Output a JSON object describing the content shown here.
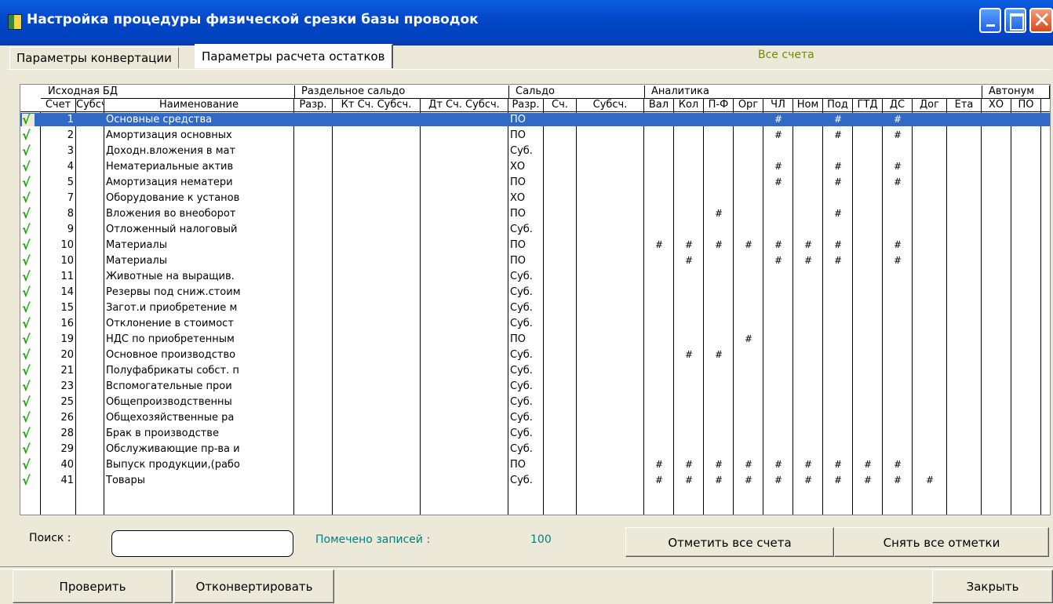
{
  "window": {
    "title": "Настройка процедуры физической срезки базы проводок"
  },
  "tabs": [
    {
      "label": "Параметры конвертации"
    },
    {
      "label": "Параметры расчета остатков"
    }
  ],
  "tabs_note": "Все счета",
  "grid": {
    "groups": [
      "Исходная БД",
      "Раздельное сальдо",
      "Сальдо",
      "Аналитика",
      "Автонум"
    ],
    "columns": [
      "Счет",
      "Субсч",
      "Наименование",
      "Разр.",
      "Кт Сч. Субсч.",
      "Дт Сч. Субсч.",
      "Разр.",
      "Сч.",
      "Субсч.",
      "Вал",
      "Кол",
      "П-Ф",
      "Орг",
      "ЧЛ",
      "Ном",
      "Под",
      "ГТД",
      "ДС",
      "Дог",
      "Ета",
      "ХО",
      "ПО"
    ],
    "rows": [
      {
        "acc": "1",
        "name": "Основные средства",
        "saldo": "ПО",
        "marks": [
          "",
          "",
          "",
          "",
          "#",
          "",
          "#",
          "",
          "#",
          "",
          ""
        ]
      },
      {
        "acc": "2",
        "name": "Амортизация основных",
        "saldo": "ПО",
        "marks": [
          "",
          "",
          "",
          "",
          "#",
          "",
          "#",
          "",
          "#",
          "",
          ""
        ]
      },
      {
        "acc": "3",
        "name": "Доходн.вложения в мат",
        "saldo": "Суб.",
        "marks": [
          "",
          "",
          "",
          "",
          "",
          "",
          "",
          "",
          "",
          "",
          ""
        ]
      },
      {
        "acc": "4",
        "name": "Нематериальные актив",
        "saldo": "ХО",
        "marks": [
          "",
          "",
          "",
          "",
          "#",
          "",
          "#",
          "",
          "#",
          "",
          ""
        ]
      },
      {
        "acc": "5",
        "name": "Амортизация нематери",
        "saldo": "ПО",
        "marks": [
          "",
          "",
          "",
          "",
          "#",
          "",
          "#",
          "",
          "#",
          "",
          ""
        ]
      },
      {
        "acc": "7",
        "name": "Оборудование к установ",
        "saldo": "ХО",
        "marks": [
          "",
          "",
          "",
          "",
          "",
          "",
          "",
          "",
          "",
          "",
          ""
        ]
      },
      {
        "acc": "8",
        "name": "Вложения во внеоборот",
        "saldo": "ПО",
        "marks": [
          "",
          "",
          "#",
          "",
          "",
          "",
          "#",
          "",
          "",
          "",
          ""
        ]
      },
      {
        "acc": "9",
        "name": "Отложенный налоговый",
        "saldo": "Суб.",
        "marks": [
          "",
          "",
          "",
          "",
          "",
          "",
          "",
          "",
          "",
          "",
          ""
        ]
      },
      {
        "acc": "10",
        "name": "Материалы",
        "saldo": "ПО",
        "marks": [
          "#",
          "#",
          "#",
          "#",
          "#",
          "#",
          "#",
          "",
          "#",
          "",
          ""
        ]
      },
      {
        "acc": "10",
        "name": "Материалы",
        "saldo": "ПО",
        "marks": [
          "",
          "#",
          "",
          "",
          "#",
          "#",
          "#",
          "",
          "#",
          "",
          ""
        ]
      },
      {
        "acc": "11",
        "name": "Животные на выращив.",
        "saldo": "Суб.",
        "marks": [
          "",
          "",
          "",
          "",
          "",
          "",
          "",
          "",
          "",
          "",
          ""
        ]
      },
      {
        "acc": "14",
        "name": "Резервы под сниж.стоим",
        "saldo": "Суб.",
        "marks": [
          "",
          "",
          "",
          "",
          "",
          "",
          "",
          "",
          "",
          "",
          ""
        ]
      },
      {
        "acc": "15",
        "name": "Загот.и приобретение м",
        "saldo": "Суб.",
        "marks": [
          "",
          "",
          "",
          "",
          "",
          "",
          "",
          "",
          "",
          "",
          ""
        ]
      },
      {
        "acc": "16",
        "name": "Отклонение в стоимост",
        "saldo": "Суб.",
        "marks": [
          "",
          "",
          "",
          "",
          "",
          "",
          "",
          "",
          "",
          "",
          ""
        ]
      },
      {
        "acc": "19",
        "name": "НДС по приобретенным",
        "saldo": "ПО",
        "marks": [
          "",
          "",
          "",
          "#",
          "",
          "",
          "",
          "",
          "",
          "",
          ""
        ]
      },
      {
        "acc": "20",
        "name": "Основное производство",
        "saldo": "Суб.",
        "marks": [
          "",
          "#",
          "#",
          "",
          "",
          "",
          "",
          "",
          "",
          "",
          ""
        ]
      },
      {
        "acc": "21",
        "name": "Полуфабрикаты собст. п",
        "saldo": "Суб.",
        "marks": [
          "",
          "",
          "",
          "",
          "",
          "",
          "",
          "",
          "",
          "",
          ""
        ]
      },
      {
        "acc": "23",
        "name": "Вспомогательные прои",
        "saldo": "Суб.",
        "marks": [
          "",
          "",
          "",
          "",
          "",
          "",
          "",
          "",
          "",
          "",
          ""
        ]
      },
      {
        "acc": "25",
        "name": "Общепроизводственны",
        "saldo": "Суб.",
        "marks": [
          "",
          "",
          "",
          "",
          "",
          "",
          "",
          "",
          "",
          "",
          ""
        ]
      },
      {
        "acc": "26",
        "name": "Общехозяйственные ра",
        "saldo": "Суб.",
        "marks": [
          "",
          "",
          "",
          "",
          "",
          "",
          "",
          "",
          "",
          "",
          ""
        ]
      },
      {
        "acc": "28",
        "name": "Брак в производстве",
        "saldo": "Суб.",
        "marks": [
          "",
          "",
          "",
          "",
          "",
          "",
          "",
          "",
          "",
          "",
          ""
        ]
      },
      {
        "acc": "29",
        "name": "Обслуживающие пр-ва и",
        "saldo": "Суб.",
        "marks": [
          "",
          "",
          "",
          "",
          "",
          "",
          "",
          "",
          "",
          "",
          ""
        ]
      },
      {
        "acc": "40",
        "name": "Выпуск продукции,(рабо",
        "saldo": "ПО",
        "marks": [
          "#",
          "#",
          "#",
          "#",
          "#",
          "#",
          "#",
          "#",
          "#",
          "",
          ""
        ]
      },
      {
        "acc": "41",
        "name": "Товары",
        "saldo": "Суб.",
        "marks": [
          "#",
          "#",
          "#",
          "#",
          "#",
          "#",
          "#",
          "#",
          "#",
          "#",
          ""
        ]
      }
    ],
    "check_glyph": "√"
  },
  "search": {
    "label": "Поиск :",
    "value": ""
  },
  "marked": {
    "label": "Помечено записей :",
    "value": "100"
  },
  "buttons": {
    "mark_all": "Отметить все счета",
    "unmark_all": "Снять все отметки",
    "check": "Проверить",
    "convert": "Отконвертировать",
    "close": "Закрыть"
  }
}
